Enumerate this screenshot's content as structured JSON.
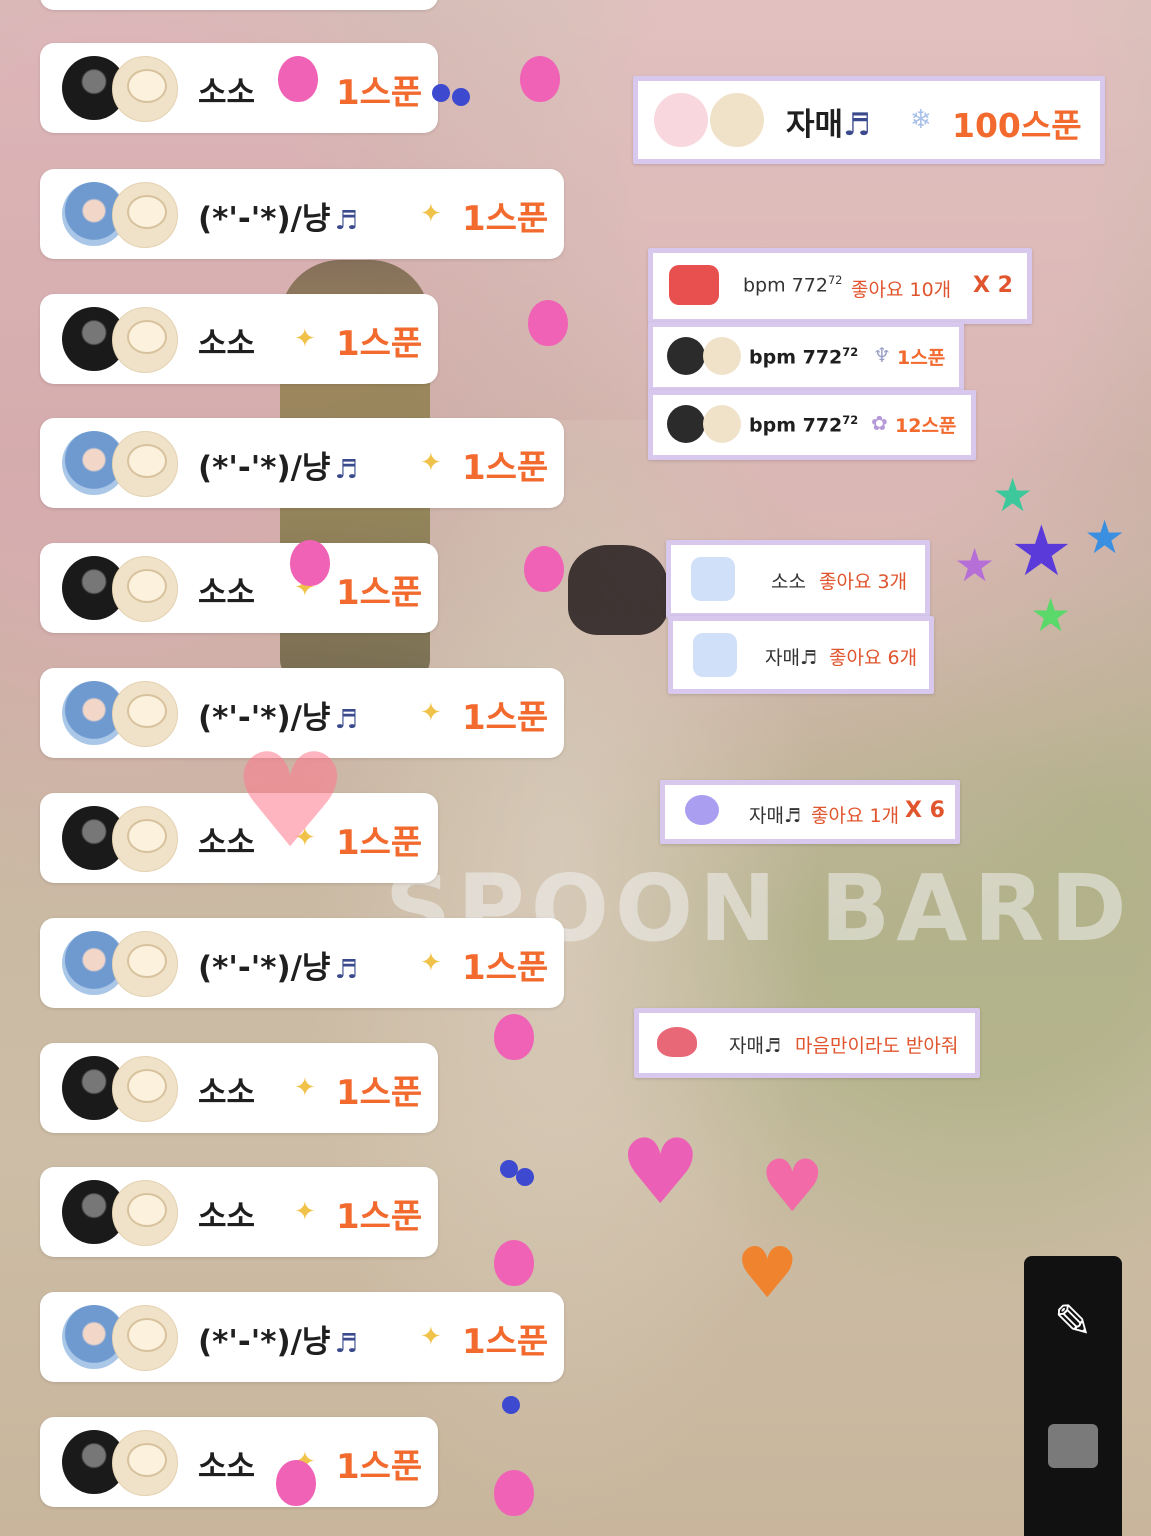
{
  "watermark": "SPOON BARD",
  "chat": [
    {
      "nick": "소소",
      "note": "",
      "amount": "1스푼",
      "avatar": "dark",
      "long": false
    },
    {
      "nick": "(*'-'*)/냥",
      "note": "♬",
      "amount": "1스푼",
      "avatar": "blue",
      "long": true
    },
    {
      "nick": "소소",
      "note": "",
      "amount": "1스푼",
      "avatar": "dark",
      "long": false
    },
    {
      "nick": "(*'-'*)/냥",
      "note": "♬",
      "amount": "1스푼",
      "avatar": "blue",
      "long": true
    },
    {
      "nick": "소소",
      "note": "",
      "amount": "1스푼",
      "avatar": "dark",
      "long": false
    },
    {
      "nick": "(*'-'*)/냥",
      "note": "♬",
      "amount": "1스푼",
      "avatar": "blue",
      "long": true
    },
    {
      "nick": "소소",
      "note": "",
      "amount": "1스푼",
      "avatar": "dark",
      "long": false
    },
    {
      "nick": "(*'-'*)/냥",
      "note": "♬",
      "amount": "1스푼",
      "avatar": "blue",
      "long": true
    },
    {
      "nick": "소소",
      "note": "",
      "amount": "1스푼",
      "avatar": "dark",
      "long": false
    },
    {
      "nick": "소소",
      "note": "",
      "amount": "1스푼",
      "avatar": "dark",
      "long": false
    },
    {
      "nick": "(*'-'*)/냥",
      "note": "♬",
      "amount": "1스푼",
      "avatar": "blue",
      "long": true
    },
    {
      "nick": "소소",
      "note": "",
      "amount": "1스푼",
      "avatar": "dark",
      "long": false
    }
  ],
  "notices": {
    "big_gift": {
      "nick": "자매",
      "note": "♬",
      "amount": "100스푼"
    },
    "like_bpm": {
      "nick": "bpm 772",
      "sup": "72",
      "text": "좋아요 10개",
      "mult": "X 2"
    },
    "gift_bpm_1": {
      "nick": "bpm 772",
      "sup": "72",
      "amount": "1스푼"
    },
    "gift_bpm_2": {
      "nick": "bpm 772",
      "sup": "72",
      "amount": "12스푼"
    },
    "like_soso": {
      "nick": "소소",
      "text": "좋아요 3개"
    },
    "like_jamae": {
      "nick": "자매♬",
      "text": "좋아요 6개"
    },
    "like_jamae_x6": {
      "nick": "자매♬",
      "text": "좋아요 1개",
      "mult": "X 6"
    },
    "message_jamae": {
      "nick": "자매♬",
      "text": "마음만이라도 받아줘"
    }
  },
  "colors": {
    "amount": "#f26a2e",
    "notice_border": "#d9c8ee",
    "like_text": "#e0552e"
  },
  "icons": {
    "pencil": "pencil-icon",
    "tray": "tray-icon"
  }
}
